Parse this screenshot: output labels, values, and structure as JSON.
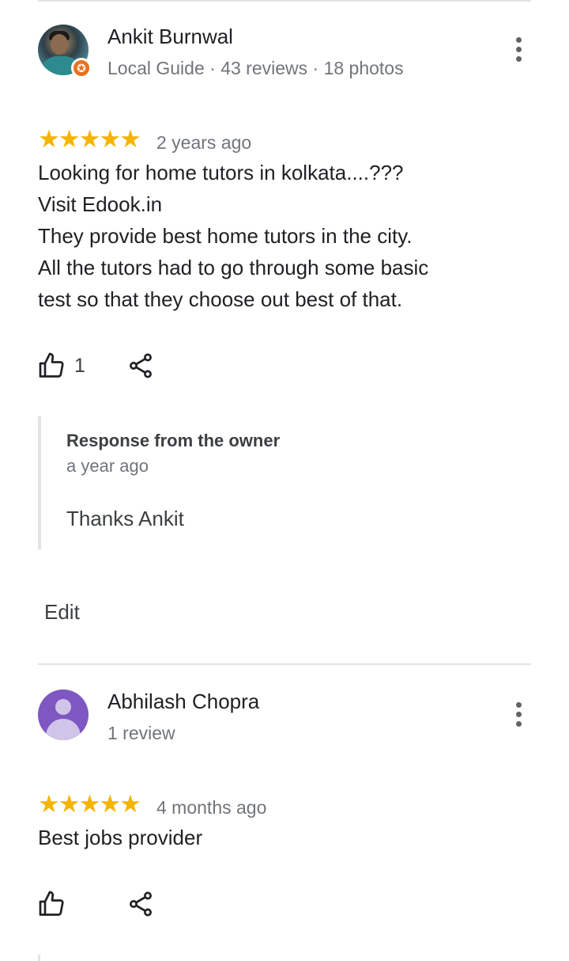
{
  "reviews": [
    {
      "author": "Ankit Burnwal",
      "meta": "Local Guide · 43 reviews · 18 photos",
      "rating": 5,
      "stars": "★★★★★",
      "time": "2 years ago",
      "text_lines": [
        "Looking for home tutors in kolkata....???",
        "Visit Edook.in",
        "They provide best home tutors in the city.",
        "All the tutors had to go through some basic",
        "test so that they choose out best of that."
      ],
      "likes": "1",
      "owner_response": {
        "title": "Response from the owner",
        "time": "a year ago",
        "text": "Thanks Ankit"
      },
      "edit_label": "Edit"
    },
    {
      "author": "Abhilash Chopra",
      "meta": "1 review",
      "rating": 5,
      "stars": "★★★★★",
      "time": "4 months ago",
      "text_lines": [
        "Best jobs provider"
      ],
      "likes": ""
    }
  ],
  "colors": {
    "star": "#f5b400",
    "local_guide_badge": "#e8711e",
    "generic_avatar": "#7e57c2"
  },
  "icons": {
    "more": "more-vert-icon",
    "like": "thumb-up-icon",
    "share": "share-icon",
    "badge": "local-guide-star-icon"
  }
}
